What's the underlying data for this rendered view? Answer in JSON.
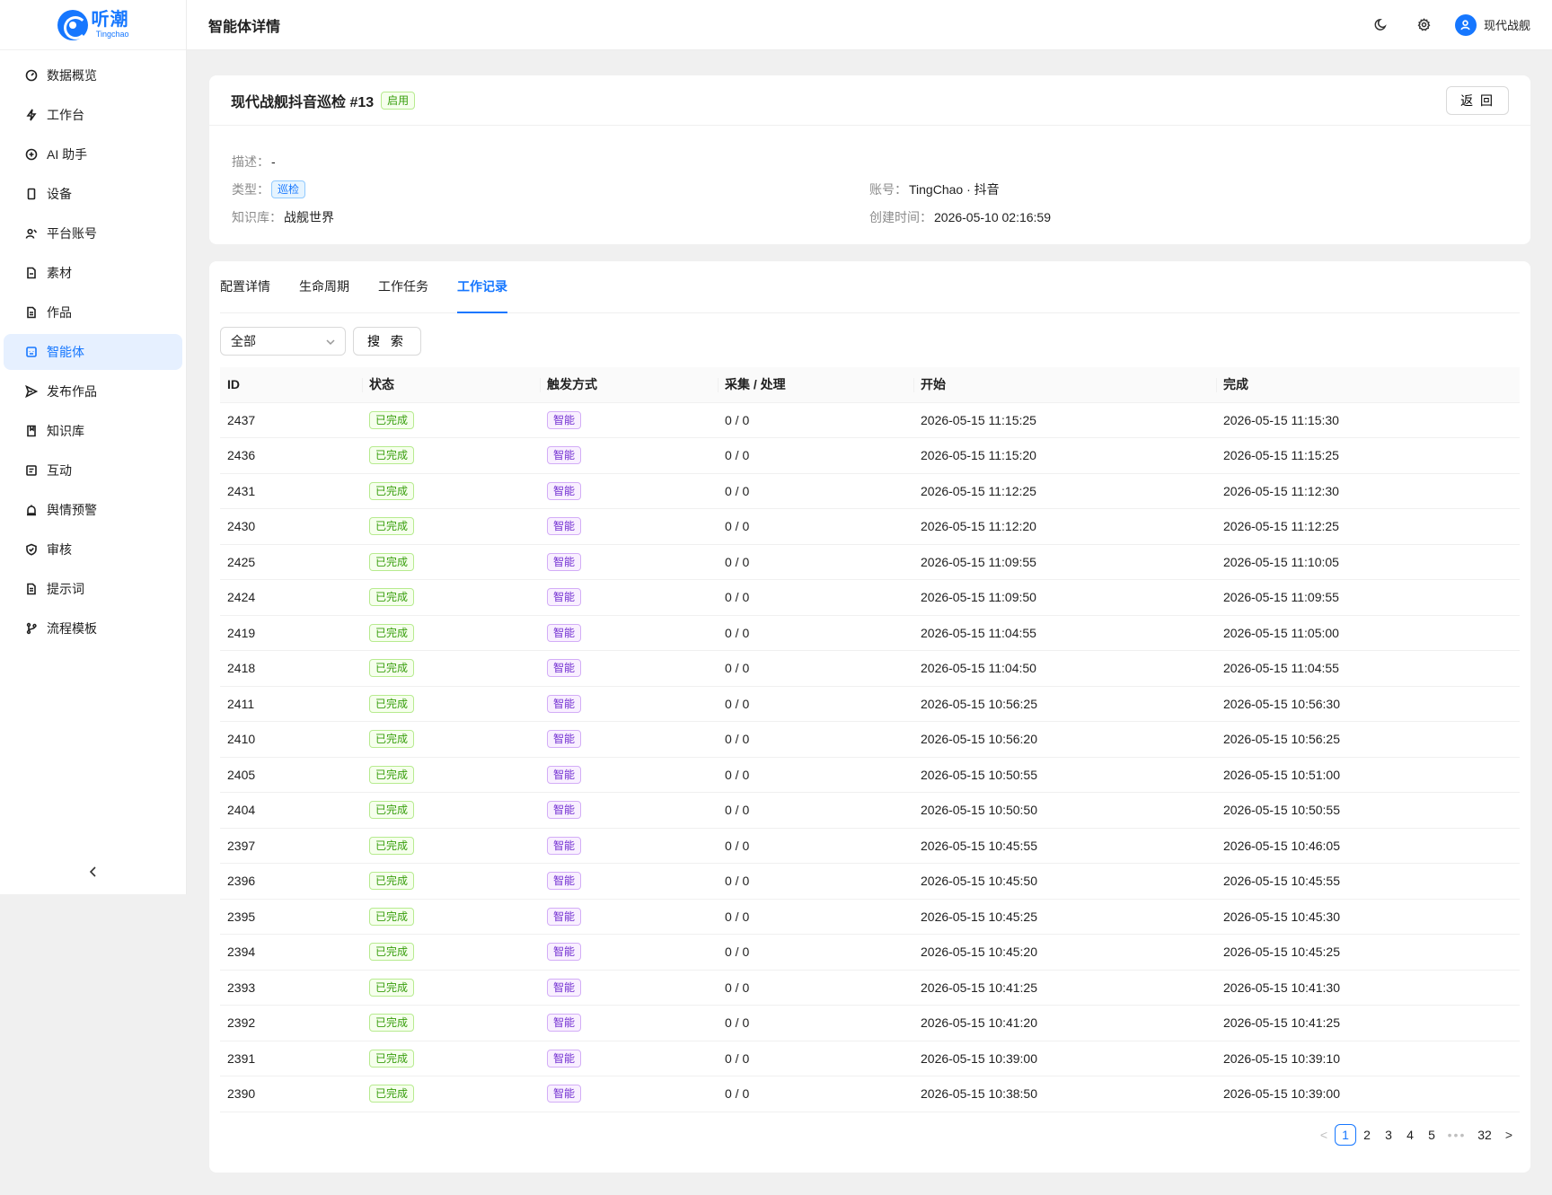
{
  "brand": {
    "name_cn": "听潮",
    "name_en": "Tingchao"
  },
  "sidebar": {
    "items": [
      {
        "label": "数据概览",
        "icon": "dashboard-icon",
        "active": false
      },
      {
        "label": "工作台",
        "icon": "lightning-icon",
        "active": false
      },
      {
        "label": "AI 助手",
        "icon": "ai-icon",
        "active": false
      },
      {
        "label": "设备",
        "icon": "phone-icon",
        "active": false
      },
      {
        "label": "平台账号",
        "icon": "users-icon",
        "active": false
      },
      {
        "label": "素材",
        "icon": "file-icon",
        "active": false
      },
      {
        "label": "作品",
        "icon": "document-icon",
        "active": false
      },
      {
        "label": "智能体",
        "icon": "robot-icon",
        "active": true
      },
      {
        "label": "发布作品",
        "icon": "send-icon",
        "active": false
      },
      {
        "label": "知识库",
        "icon": "book-icon",
        "active": false
      },
      {
        "label": "互动",
        "icon": "chat-icon",
        "active": false
      },
      {
        "label": "舆情预警",
        "icon": "alarm-icon",
        "active": false
      },
      {
        "label": "审核",
        "icon": "shield-icon",
        "active": false
      },
      {
        "label": "提示词",
        "icon": "note-icon",
        "active": false
      },
      {
        "label": "流程模板",
        "icon": "branch-icon",
        "active": false
      }
    ],
    "collapse_label": "<"
  },
  "header": {
    "title": "智能体详情",
    "user_name": "现代战舰"
  },
  "agent": {
    "title": "现代战舰抖音巡检 #13",
    "status": "启用",
    "back_label": "返 回",
    "desc_key": "描述：",
    "desc_val": "-",
    "type_key": "类型：",
    "type_val": "巡检",
    "kb_key": "知识库：",
    "kb_val": "战舰世界",
    "account_key": "账号：",
    "account_val": "TingChao · 抖音",
    "created_key": "创建时间：",
    "created_val": "2026-05-10 02:16:59"
  },
  "tabs": [
    {
      "label": "配置详情",
      "active": false
    },
    {
      "label": "生命周期",
      "active": false
    },
    {
      "label": "工作任务",
      "active": false
    },
    {
      "label": "工作记录",
      "active": true
    }
  ],
  "filter": {
    "select_value": "全部",
    "search_label": "搜 索"
  },
  "table": {
    "columns": [
      "ID",
      "状态",
      "触发方式",
      "采集 / 处理",
      "开始",
      "完成"
    ],
    "rows": [
      {
        "id": "2437",
        "status": "已完成",
        "trigger": "智能",
        "count": "0 / 0",
        "start": "2026-05-15 11:15:25",
        "end": "2026-05-15 11:15:30"
      },
      {
        "id": "2436",
        "status": "已完成",
        "trigger": "智能",
        "count": "0 / 0",
        "start": "2026-05-15 11:15:20",
        "end": "2026-05-15 11:15:25"
      },
      {
        "id": "2431",
        "status": "已完成",
        "trigger": "智能",
        "count": "0 / 0",
        "start": "2026-05-15 11:12:25",
        "end": "2026-05-15 11:12:30"
      },
      {
        "id": "2430",
        "status": "已完成",
        "trigger": "智能",
        "count": "0 / 0",
        "start": "2026-05-15 11:12:20",
        "end": "2026-05-15 11:12:25"
      },
      {
        "id": "2425",
        "status": "已完成",
        "trigger": "智能",
        "count": "0 / 0",
        "start": "2026-05-15 11:09:55",
        "end": "2026-05-15 11:10:05"
      },
      {
        "id": "2424",
        "status": "已完成",
        "trigger": "智能",
        "count": "0 / 0",
        "start": "2026-05-15 11:09:50",
        "end": "2026-05-15 11:09:55"
      },
      {
        "id": "2419",
        "status": "已完成",
        "trigger": "智能",
        "count": "0 / 0",
        "start": "2026-05-15 11:04:55",
        "end": "2026-05-15 11:05:00"
      },
      {
        "id": "2418",
        "status": "已完成",
        "trigger": "智能",
        "count": "0 / 0",
        "start": "2026-05-15 11:04:50",
        "end": "2026-05-15 11:04:55"
      },
      {
        "id": "2411",
        "status": "已完成",
        "trigger": "智能",
        "count": "0 / 0",
        "start": "2026-05-15 10:56:25",
        "end": "2026-05-15 10:56:30"
      },
      {
        "id": "2410",
        "status": "已完成",
        "trigger": "智能",
        "count": "0 / 0",
        "start": "2026-05-15 10:56:20",
        "end": "2026-05-15 10:56:25"
      },
      {
        "id": "2405",
        "status": "已完成",
        "trigger": "智能",
        "count": "0 / 0",
        "start": "2026-05-15 10:50:55",
        "end": "2026-05-15 10:51:00"
      },
      {
        "id": "2404",
        "status": "已完成",
        "trigger": "智能",
        "count": "0 / 0",
        "start": "2026-05-15 10:50:50",
        "end": "2026-05-15 10:50:55"
      },
      {
        "id": "2397",
        "status": "已完成",
        "trigger": "智能",
        "count": "0 / 0",
        "start": "2026-05-15 10:45:55",
        "end": "2026-05-15 10:46:05"
      },
      {
        "id": "2396",
        "status": "已完成",
        "trigger": "智能",
        "count": "0 / 0",
        "start": "2026-05-15 10:45:50",
        "end": "2026-05-15 10:45:55"
      },
      {
        "id": "2395",
        "status": "已完成",
        "trigger": "智能",
        "count": "0 / 0",
        "start": "2026-05-15 10:45:25",
        "end": "2026-05-15 10:45:30"
      },
      {
        "id": "2394",
        "status": "已完成",
        "trigger": "智能",
        "count": "0 / 0",
        "start": "2026-05-15 10:45:20",
        "end": "2026-05-15 10:45:25"
      },
      {
        "id": "2393",
        "status": "已完成",
        "trigger": "智能",
        "count": "0 / 0",
        "start": "2026-05-15 10:41:25",
        "end": "2026-05-15 10:41:30"
      },
      {
        "id": "2392",
        "status": "已完成",
        "trigger": "智能",
        "count": "0 / 0",
        "start": "2026-05-15 10:41:20",
        "end": "2026-05-15 10:41:25"
      },
      {
        "id": "2391",
        "status": "已完成",
        "trigger": "智能",
        "count": "0 / 0",
        "start": "2026-05-15 10:39:00",
        "end": "2026-05-15 10:39:10"
      },
      {
        "id": "2390",
        "status": "已完成",
        "trigger": "智能",
        "count": "0 / 0",
        "start": "2026-05-15 10:38:50",
        "end": "2026-05-15 10:39:00"
      }
    ]
  },
  "pagination": {
    "pages": [
      "1",
      "2",
      "3",
      "4",
      "5"
    ],
    "ellipsis": "•••",
    "last": "32",
    "current": "1",
    "prev": "<",
    "next": ">"
  },
  "colors": {
    "primary": "#1677ff",
    "success": "#389e0d",
    "purple": "#722ed1"
  }
}
